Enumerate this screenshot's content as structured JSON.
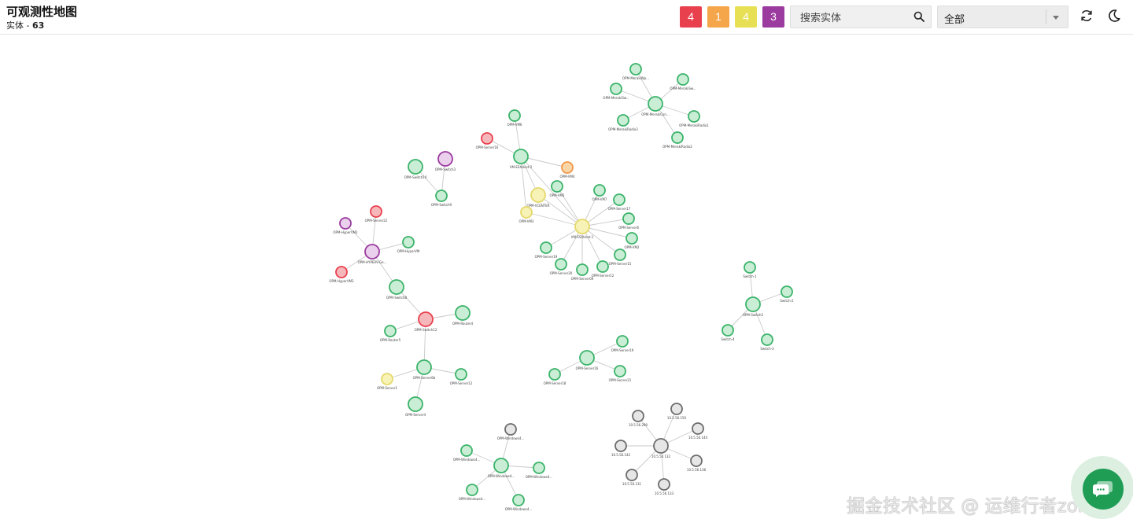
{
  "header": {
    "title": "可观测性地图",
    "entity_label": "实体 - ",
    "entity_count": "63"
  },
  "status_badges": [
    {
      "label": "4",
      "color": "#e8404d"
    },
    {
      "label": "1",
      "color": "#f5a54a"
    },
    {
      "label": "4",
      "color": "#e7e054"
    },
    {
      "label": "3",
      "color": "#9b3a9f"
    }
  ],
  "search": {
    "placeholder": "搜索实体",
    "value": "",
    "icon": "search-icon"
  },
  "filter": {
    "selected": "全部",
    "icon": "chevron-down-icon"
  },
  "actions": {
    "refresh_icon": "refresh-icon",
    "theme_icon": "moon-icon"
  },
  "status_colors": {
    "green": {
      "fill": "#c9eed5",
      "stroke": "#3bb36a"
    },
    "red": {
      "fill": "#f6b7bb",
      "stroke": "#e8404d"
    },
    "orange": {
      "fill": "#fbd7a8",
      "stroke": "#f0964a"
    },
    "yellow": {
      "fill": "#f7f2b6",
      "stroke": "#e5d96b"
    },
    "purple": {
      "fill": "#ead0ec",
      "stroke": "#9b3a9f"
    },
    "gray": {
      "fill": "#e6e6e6",
      "stroke": "#6d6d6d"
    }
  },
  "graph": {
    "nodes": [
      {
        "id": "a1",
        "label": "OPM-MerakiWp...",
        "status": "green"
      },
      {
        "id": "a2",
        "label": "OPM-MerakiSw...",
        "status": "green"
      },
      {
        "id": "a3",
        "label": "OPM-MerakiSw...",
        "status": "green"
      },
      {
        "id": "a4",
        "label": "OPM-MerakiCon...",
        "status": "green"
      },
      {
        "id": "a5",
        "label": "OPM-MerakiRadio1",
        "status": "green"
      },
      {
        "id": "a6",
        "label": "OPM-MerakiRadio3",
        "status": "green"
      },
      {
        "id": "a7",
        "label": "OPM-MerakiRadio2",
        "status": "green"
      },
      {
        "id": "b1",
        "label": "OPM-VM6",
        "status": "green"
      },
      {
        "id": "b2",
        "label": "OPM-Server16",
        "status": "red"
      },
      {
        "id": "b3",
        "label": "VM-ESXHost-2",
        "status": "green"
      },
      {
        "id": "b4",
        "label": "OPM-VM4",
        "status": "orange"
      },
      {
        "id": "b5",
        "label": "OPM-VM5",
        "status": "green"
      },
      {
        "id": "b6",
        "label": "OPM-VCENTER",
        "status": "yellow"
      },
      {
        "id": "b7",
        "label": "OPM-VM3",
        "status": "yellow"
      },
      {
        "id": "b8",
        "label": "OPM-VM7",
        "status": "green"
      },
      {
        "id": "b9",
        "label": "OPM-Server17",
        "status": "green"
      },
      {
        "id": "b10",
        "label": "OPM-Server6",
        "status": "green"
      },
      {
        "id": "b11",
        "label": "VM-ESXHost-1",
        "status": "yellow"
      },
      {
        "id": "b12",
        "label": "OPM-VM2",
        "status": "green"
      },
      {
        "id": "b13",
        "label": "OPM-Server19",
        "status": "green"
      },
      {
        "id": "b14",
        "label": "OPM-Server20",
        "status": "green"
      },
      {
        "id": "b15",
        "label": "OPM-Server09",
        "status": "green"
      },
      {
        "id": "b16",
        "label": "OPM-Server12",
        "status": "green"
      },
      {
        "id": "b17",
        "label": "OPM-Server15",
        "status": "green"
      },
      {
        "id": "c1",
        "label": "OPM-Switch10",
        "status": "green"
      },
      {
        "id": "c2",
        "label": "OPM-Switch3",
        "status": "purple"
      },
      {
        "id": "c3",
        "label": "OPM-Switch9",
        "status": "green"
      },
      {
        "id": "d1",
        "label": "OPM-Server22",
        "status": "red"
      },
      {
        "id": "d2",
        "label": "OPM-HyperVM2",
        "status": "purple"
      },
      {
        "id": "d3",
        "label": "OPM-HyperVM",
        "status": "green"
      },
      {
        "id": "d4",
        "label": "OPM-HYPERV-Ge...",
        "status": "purple"
      },
      {
        "id": "d5",
        "label": "OPM-HyperVM3",
        "status": "red"
      },
      {
        "id": "d6",
        "label": "OPM-Switch8",
        "status": "green"
      },
      {
        "id": "d7",
        "label": "OPM-Switch12",
        "status": "red"
      },
      {
        "id": "d8",
        "label": "OPM-Router4",
        "status": "green"
      },
      {
        "id": "d9",
        "label": "OPM-Router5",
        "status": "green"
      },
      {
        "id": "d10",
        "label": "OPM-Server6b",
        "status": "green"
      },
      {
        "id": "d11",
        "label": "OPM-Server1",
        "status": "yellow"
      },
      {
        "id": "d12",
        "label": "OPM-Server12",
        "status": "green"
      },
      {
        "id": "d13",
        "label": "OPM-Server4",
        "status": "green"
      },
      {
        "id": "e1",
        "label": "Switch-1",
        "status": "green"
      },
      {
        "id": "e2",
        "label": "Switch-2",
        "status": "green"
      },
      {
        "id": "e3",
        "label": "OPM-Switch2",
        "status": "green"
      },
      {
        "id": "e4",
        "label": "Switch-4",
        "status": "green"
      },
      {
        "id": "e5",
        "label": "Switch-3",
        "status": "green"
      },
      {
        "id": "f1",
        "label": "OPM-Server19",
        "status": "green"
      },
      {
        "id": "f2",
        "label": "OPM-Server18",
        "status": "green"
      },
      {
        "id": "f3",
        "label": "OPM-Server16",
        "status": "green"
      },
      {
        "id": "f4",
        "label": "OPM-Server21",
        "status": "green"
      },
      {
        "id": "g1",
        "label": "OPM-Windows4...",
        "status": "gray"
      },
      {
        "id": "g2",
        "label": "OPM-Windows4...",
        "status": "green"
      },
      {
        "id": "g3",
        "label": "OPM-Windows4...",
        "status": "green"
      },
      {
        "id": "g4",
        "label": "OPM-Windows4...",
        "status": "green"
      },
      {
        "id": "g5",
        "label": "OPM-Windows4...",
        "status": "green"
      },
      {
        "id": "g6",
        "label": "OPM-Windows4...",
        "status": "green"
      },
      {
        "id": "h1",
        "label": "10.5.56.290",
        "status": "gray"
      },
      {
        "id": "h2",
        "label": "10.5.56.150",
        "status": "gray"
      },
      {
        "id": "h3",
        "label": "10.5.50.144",
        "status": "gray"
      },
      {
        "id": "h4",
        "label": "10.5.56.142",
        "status": "gray"
      },
      {
        "id": "h5",
        "label": "10.5.50.132",
        "status": "gray"
      },
      {
        "id": "h6",
        "label": "10.5.56.138",
        "status": "gray"
      },
      {
        "id": "h7",
        "label": "10.5.50.131",
        "status": "gray"
      },
      {
        "id": "h8",
        "label": "10.5.56.133",
        "status": "gray"
      }
    ],
    "edges": [
      [
        "a4",
        "a1"
      ],
      [
        "a4",
        "a2"
      ],
      [
        "a4",
        "a3"
      ],
      [
        "a4",
        "a5"
      ],
      [
        "a4",
        "a6"
      ],
      [
        "a4",
        "a7"
      ],
      [
        "b3",
        "b1"
      ],
      [
        "b3",
        "b2"
      ],
      [
        "b3",
        "b4"
      ],
      [
        "b3",
        "b6"
      ],
      [
        "b3",
        "b7"
      ],
      [
        "b3",
        "b11"
      ],
      [
        "b11",
        "b5"
      ],
      [
        "b11",
        "b6"
      ],
      [
        "b11",
        "b7"
      ],
      [
        "b11",
        "b8"
      ],
      [
        "b11",
        "b9"
      ],
      [
        "b11",
        "b10"
      ],
      [
        "b11",
        "b12"
      ],
      [
        "b11",
        "b13"
      ],
      [
        "b11",
        "b14"
      ],
      [
        "b11",
        "b15"
      ],
      [
        "b11",
        "b16"
      ],
      [
        "b11",
        "b17"
      ],
      [
        "c2",
        "c3"
      ],
      [
        "c1",
        "c3"
      ],
      [
        "d4",
        "d1"
      ],
      [
        "d4",
        "d2"
      ],
      [
        "d4",
        "d3"
      ],
      [
        "d4",
        "d5"
      ],
      [
        "d4",
        "d6"
      ],
      [
        "d6",
        "d7"
      ],
      [
        "d7",
        "d8"
      ],
      [
        "d7",
        "d9"
      ],
      [
        "d7",
        "d10"
      ],
      [
        "d10",
        "d11"
      ],
      [
        "d10",
        "d12"
      ],
      [
        "d10",
        "d13"
      ],
      [
        "e3",
        "e1"
      ],
      [
        "e3",
        "e2"
      ],
      [
        "e3",
        "e4"
      ],
      [
        "e3",
        "e5"
      ],
      [
        "f3",
        "f1"
      ],
      [
        "f3",
        "f2"
      ],
      [
        "f3",
        "f4"
      ],
      [
        "g3",
        "g1"
      ],
      [
        "g3",
        "g2"
      ],
      [
        "g3",
        "g4"
      ],
      [
        "g3",
        "g5"
      ],
      [
        "g3",
        "g6"
      ],
      [
        "h5",
        "h1"
      ],
      [
        "h5",
        "h2"
      ],
      [
        "h5",
        "h3"
      ],
      [
        "h5",
        "h4"
      ],
      [
        "h5",
        "h6"
      ],
      [
        "h5",
        "h7"
      ],
      [
        "h5",
        "h8"
      ]
    ]
  },
  "watermark": "掘金技术社区 @ 运维行者zoho",
  "chat": {
    "icon": "chat-icon"
  }
}
